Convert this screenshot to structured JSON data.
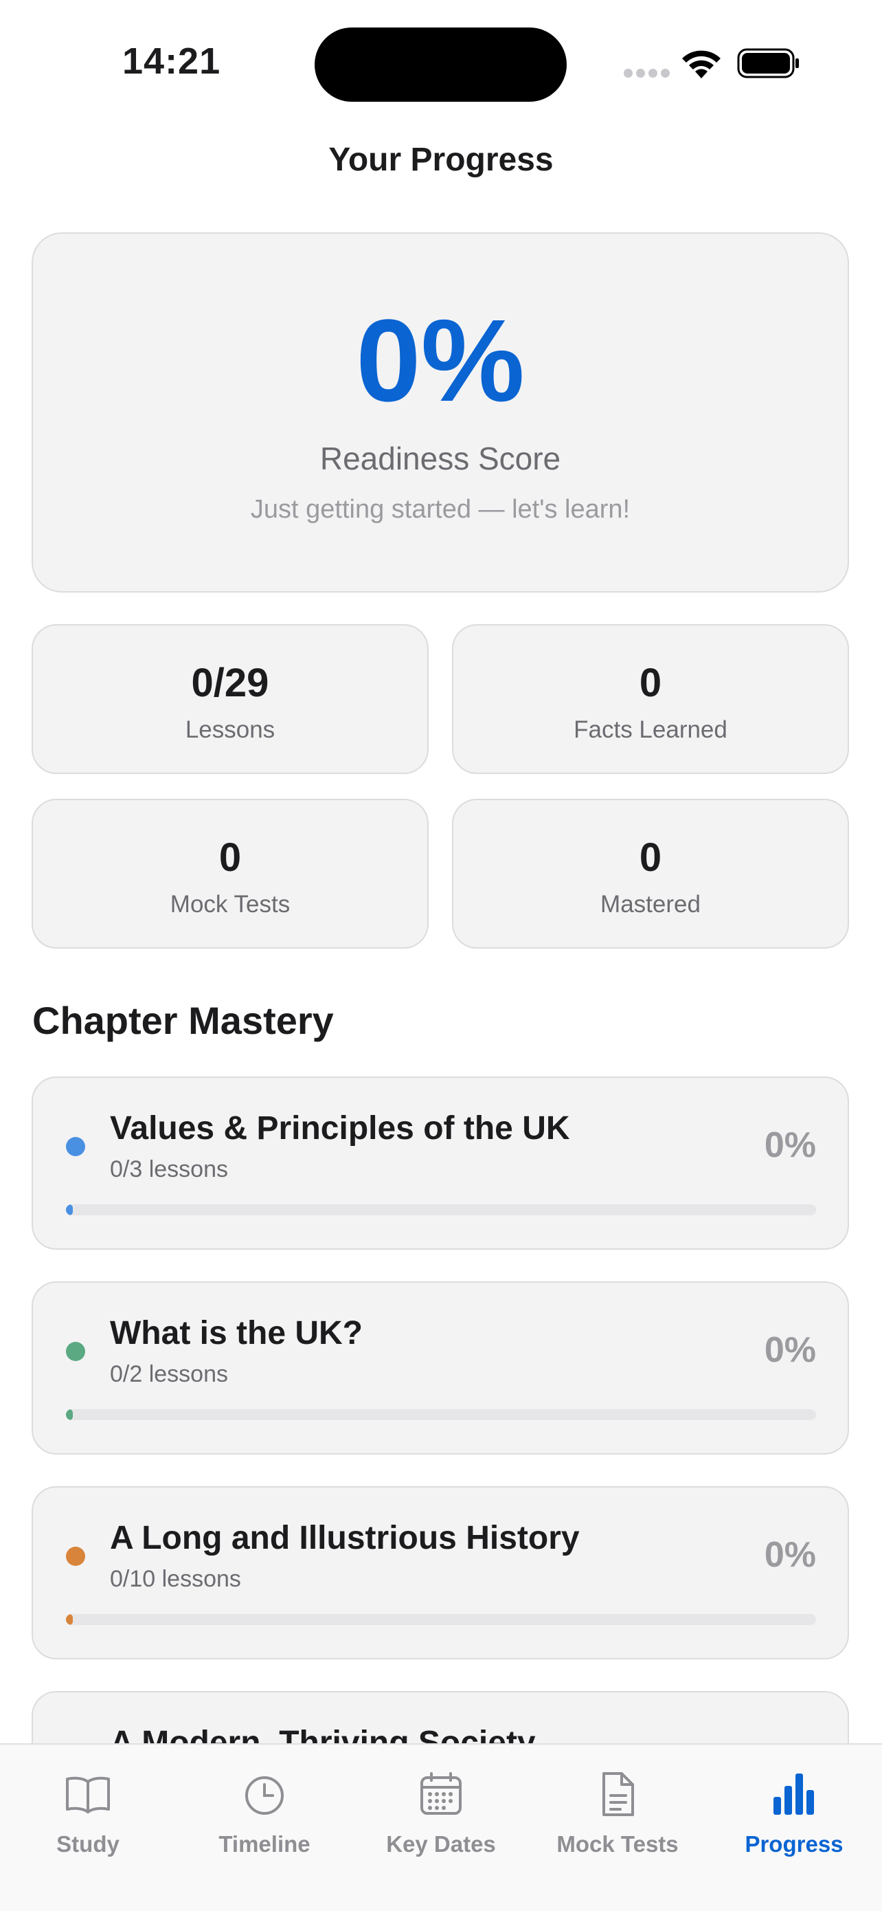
{
  "status": {
    "time": "14:21"
  },
  "header": {
    "title": "Your Progress"
  },
  "readiness": {
    "score": "0%",
    "label": "Readiness Score",
    "subtitle": "Just getting started — let's learn!"
  },
  "stats": [
    {
      "value": "0/29",
      "label": "Lessons"
    },
    {
      "value": "0",
      "label": "Facts Learned"
    },
    {
      "value": "0",
      "label": "Mock Tests"
    },
    {
      "value": "0",
      "label": "Mastered"
    }
  ],
  "chapter_section": {
    "title": "Chapter Mastery",
    "chapters": [
      {
        "title": "Values & Principles of the UK",
        "lessons": "0/3 lessons",
        "percent": "0%",
        "progress": 0,
        "color": "#4a90e2"
      },
      {
        "title": "What is the UK?",
        "lessons": "0/2 lessons",
        "percent": "0%",
        "progress": 0,
        "color": "#5aa982"
      },
      {
        "title": "A Long and Illustrious History",
        "lessons": "0/10 lessons",
        "percent": "0%",
        "progress": 0,
        "color": "#d9843b"
      },
      {
        "title": "A Modern, Thriving Society",
        "color": "#8a6bd1"
      }
    ]
  },
  "tabs": [
    {
      "label": "Study",
      "icon": "book-icon",
      "active": false
    },
    {
      "label": "Timeline",
      "icon": "clock-icon",
      "active": false
    },
    {
      "label": "Key Dates",
      "icon": "calendar-icon",
      "active": false
    },
    {
      "label": "Mock Tests",
      "icon": "document-icon",
      "active": false
    },
    {
      "label": "Progress",
      "icon": "bar-chart-icon",
      "active": true
    }
  ],
  "colors": {
    "accent": "#0a64d2",
    "inactive": "#8e8e93"
  }
}
